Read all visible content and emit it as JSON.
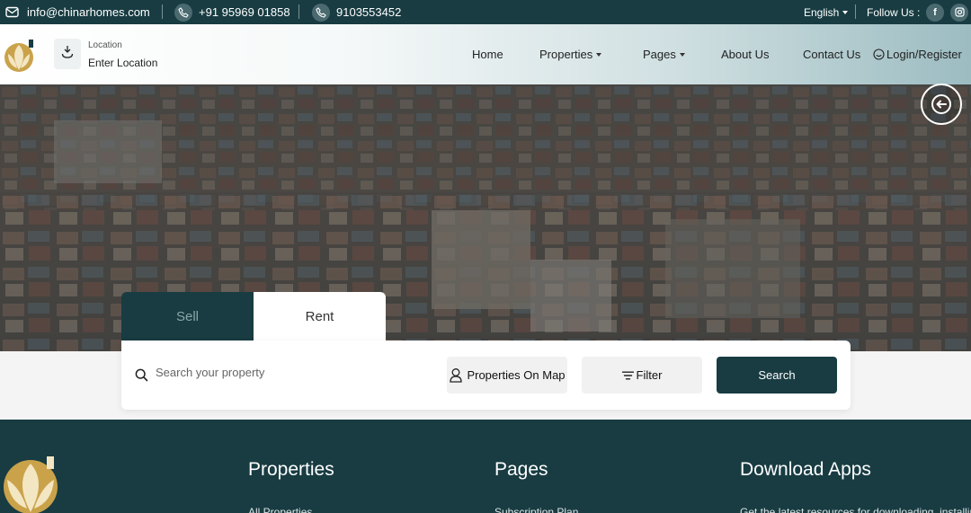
{
  "topbar": {
    "email": "info@chinarhomes.com",
    "phone1": "+91 95969 01858",
    "phone2": "9103553452",
    "language": "English",
    "follow_label": "Follow Us :",
    "social": [
      "facebook-icon",
      "instagram-icon"
    ]
  },
  "nav": {
    "location_label": "Location",
    "location_value": "Enter Location",
    "links": {
      "home": "Home",
      "properties": "Properties",
      "pages": "Pages",
      "about": "About Us",
      "contact": "Contact Us",
      "login": "Login/Register"
    }
  },
  "search": {
    "tabs": {
      "sell": "Sell",
      "rent": "Rent"
    },
    "active_tab": "Sell",
    "placeholder": "Search your property",
    "map_label": "Properties On Map",
    "filter_label": "Filter",
    "search_label": "Search"
  },
  "footer": {
    "properties_heading": "Properties",
    "properties_first_link": "All Properties",
    "pages_heading": "Pages",
    "pages_first_link": "Subscription Plan",
    "apps_heading": "Download Apps",
    "apps_text": "Get the latest resources for downloading, installing"
  },
  "colors": {
    "brand_dark": "#183c42",
    "logo_gold": "#c9a24a",
    "logo_cream": "#f3e6c2"
  }
}
